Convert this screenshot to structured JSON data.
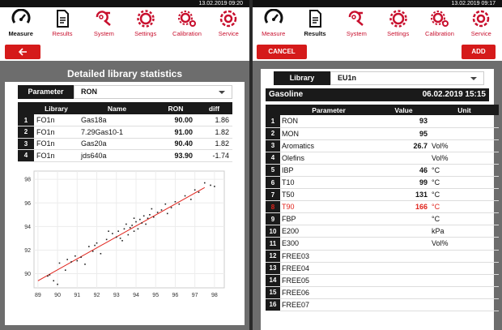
{
  "left": {
    "timestamp": "13.02.2019 09:20",
    "nav": [
      {
        "label": "Measure",
        "icon": "gauge-icon",
        "active": true
      },
      {
        "label": "Results",
        "icon": "document-icon",
        "active": false
      },
      {
        "label": "System",
        "icon": "wrench-icon",
        "active": false
      },
      {
        "label": "Settings",
        "icon": "gear-icon",
        "active": false
      },
      {
        "label": "Calibration",
        "icon": "gears-icon",
        "active": false
      },
      {
        "label": "Service",
        "icon": "service-gear-icon",
        "active": false
      }
    ],
    "back_icon": "arrow-left-icon",
    "title": "Detailed library statistics",
    "param_label": "Parameter",
    "param_value": "RON",
    "table": {
      "headers": [
        "",
        "Library",
        "Name",
        "RON",
        "diff"
      ],
      "rows": [
        [
          "1",
          "FO1n",
          "Gas18a",
          "90.00",
          "1.86"
        ],
        [
          "2",
          "FO1n",
          "7.29Gas10-1",
          "91.00",
          "1.82"
        ],
        [
          "3",
          "FO1n",
          "Gas20a",
          "90.40",
          "1.82"
        ],
        [
          "4",
          "FO1n",
          "jds640a",
          "93.90",
          "-1.74"
        ]
      ]
    }
  },
  "chart_data": {
    "type": "scatter",
    "title": "",
    "xlabel": "",
    "ylabel": "",
    "xlim": [
      88.8,
      98.5
    ],
    "ylim": [
      88.8,
      98.7
    ],
    "xticks": [
      89,
      90,
      91,
      92,
      93,
      94,
      95,
      96,
      97,
      98
    ],
    "yticks": [
      90,
      92,
      94,
      96,
      98
    ],
    "regression_line": {
      "x": [
        89.0,
        97.5
      ],
      "y": [
        89.4,
        97.3
      ],
      "color": "#e0231b"
    },
    "points": [
      [
        89.5,
        89.8
      ],
      [
        89.8,
        89.4
      ],
      [
        90.1,
        90.9
      ],
      [
        89.6,
        89.9
      ],
      [
        90.4,
        90.3
      ],
      [
        90.5,
        91.2
      ],
      [
        90.7,
        91.0
      ],
      [
        90.0,
        89.1
      ],
      [
        90.9,
        91.5
      ],
      [
        91.2,
        91.4
      ],
      [
        91.0,
        91.1
      ],
      [
        91.6,
        92.3
      ],
      [
        91.8,
        91.9
      ],
      [
        92.0,
        92.6
      ],
      [
        92.2,
        91.7
      ],
      [
        91.9,
        92.4
      ],
      [
        92.5,
        92.9
      ],
      [
        92.8,
        93.4
      ],
      [
        93.0,
        93.1
      ],
      [
        93.1,
        93.6
      ],
      [
        93.2,
        93.0
      ],
      [
        93.4,
        93.8
      ],
      [
        93.5,
        94.2
      ],
      [
        93.6,
        93.3
      ],
      [
        93.7,
        93.9
      ],
      [
        93.8,
        94.1
      ],
      [
        93.9,
        93.6
      ],
      [
        94.0,
        94.4
      ],
      [
        94.1,
        93.8
      ],
      [
        94.2,
        94.6
      ],
      [
        94.3,
        94.3
      ],
      [
        94.4,
        94.9
      ],
      [
        94.5,
        94.2
      ],
      [
        94.6,
        94.7
      ],
      [
        94.7,
        95.0
      ],
      [
        94.9,
        94.8
      ],
      [
        95.1,
        95.2
      ],
      [
        95.3,
        95.4
      ],
      [
        95.5,
        95.9
      ],
      [
        95.8,
        95.6
      ],
      [
        96.0,
        96.1
      ],
      [
        96.2,
        95.9
      ],
      [
        96.5,
        96.6
      ],
      [
        96.8,
        96.3
      ],
      [
        97.0,
        97.1
      ],
      [
        97.2,
        96.9
      ],
      [
        97.5,
        97.7
      ],
      [
        97.8,
        97.5
      ],
      [
        98.0,
        97.4
      ],
      [
        93.3,
        92.8
      ],
      [
        92.6,
        93.6
      ],
      [
        94.8,
        95.5
      ],
      [
        95.6,
        95.1
      ],
      [
        91.4,
        90.8
      ],
      [
        93.9,
        94.7
      ]
    ]
  },
  "right": {
    "timestamp": "13.02.2019 09:17",
    "nav": [
      {
        "label": "Measure",
        "icon": "gauge-icon",
        "active": false
      },
      {
        "label": "Results",
        "icon": "document-icon",
        "active": true
      },
      {
        "label": "System",
        "icon": "wrench-icon",
        "active": false
      },
      {
        "label": "Settings",
        "icon": "gear-icon",
        "active": false
      },
      {
        "label": "Calibration",
        "icon": "gears-icon",
        "active": false
      },
      {
        "label": "Service",
        "icon": "service-gear-icon",
        "active": false
      }
    ],
    "cancel_label": "CANCEL",
    "add_label": "ADD",
    "library_label": "Library",
    "library_value": "EU1n",
    "sample_name": "Gasoline",
    "sample_date": "06.02.2019 15:15",
    "table": {
      "headers": [
        "",
        "Parameter",
        "Value",
        "Unit"
      ],
      "rows": [
        [
          "1",
          "RON",
          "93",
          ""
        ],
        [
          "2",
          "MON",
          "95",
          ""
        ],
        [
          "3",
          "Aromatics",
          "26.7",
          "Vol%"
        ],
        [
          "4",
          "Olefins",
          "",
          "Vol%"
        ],
        [
          "5",
          "IBP",
          "46",
          "°C"
        ],
        [
          "6",
          "T10",
          "99",
          "°C"
        ],
        [
          "7",
          "T50",
          "131",
          "°C"
        ],
        [
          "8",
          "T90",
          "166",
          "°C"
        ],
        [
          "9",
          "FBP",
          "",
          "°C"
        ],
        [
          "10",
          "E200",
          "",
          "kPa"
        ],
        [
          "11",
          "E300",
          "",
          "Vol%"
        ],
        [
          "12",
          "FREE03",
          "",
          ""
        ],
        [
          "13",
          "FREE04",
          "",
          ""
        ],
        [
          "14",
          "FREE05",
          "",
          ""
        ],
        [
          "15",
          "FREE06",
          "",
          ""
        ],
        [
          "16",
          "FREE07",
          "",
          ""
        ]
      ],
      "alert_row": 8,
      "alert_color": "#e0231b"
    }
  },
  "colors": {
    "accent": "#d51a1a",
    "dark": "#1a1a1a",
    "panel_bg": "#6d6d6d"
  }
}
